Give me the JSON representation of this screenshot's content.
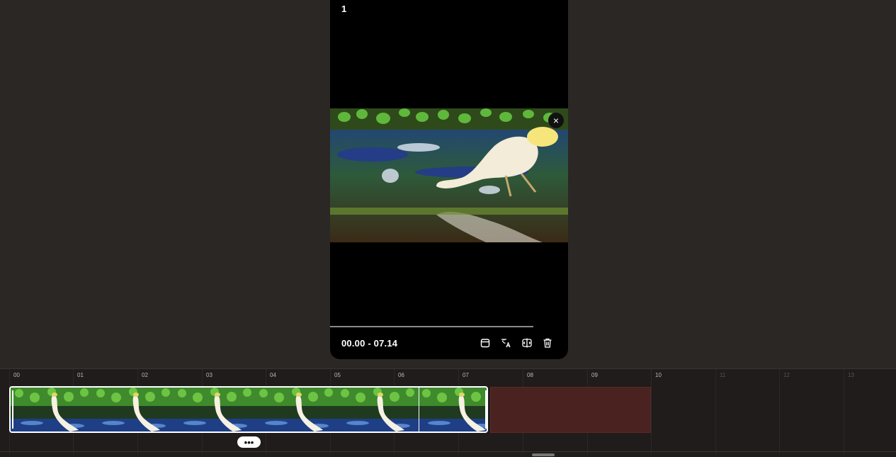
{
  "preview": {
    "page_number": "1",
    "time_range": "00.00 - 07.14",
    "close_symbol": "×",
    "tools": [
      "calendar-icon",
      "translate-icon",
      "split-icon",
      "trash-icon"
    ]
  },
  "timeline": {
    "ticks": [
      "00",
      "01",
      "02",
      "03",
      "04",
      "05",
      "06",
      "07",
      "08",
      "09",
      "10",
      "11",
      "12",
      "13"
    ],
    "more_label": "•••",
    "clip_frames": 6,
    "colors": {
      "empty_zone": "#4a2320",
      "clip_border": "#ffffff"
    }
  }
}
